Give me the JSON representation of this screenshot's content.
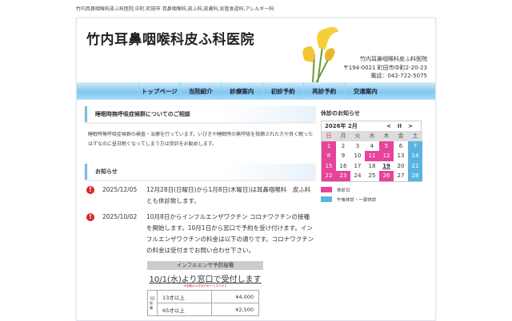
{
  "top_text": "竹内耳鼻咽喉科皮ふ科医院,中町,町田市 耳鼻咽喉科,皮ふ科,皮膚科,気管食道科,アレルギー科",
  "header": {
    "logo": "竹内耳鼻咽喉科皮ふ科医院",
    "address": [
      "竹内耳鼻咽喉科皮ふ科医院",
      "〒194-0021 町田市中町2-20-23",
      "電話：042-722-5075"
    ]
  },
  "nav": [
    "トップページ",
    "当院紹介",
    "診療案内",
    "初診予約",
    "再診予約",
    "交通案内"
  ],
  "section1": {
    "title": "睡眠時無呼吸症候群についてのご相談",
    "body": "睡眠時無呼吸症候群の検査・治療を行っています。いびきや睡眠時の無呼吸を指摘された方や良く眠ったはずなのに昼日眠くなってしまう方は受診をお勧めします。"
  },
  "section2": {
    "title": "お知らせ",
    "news": [
      {
        "icon": "alert-icon",
        "date": "2025/12/05",
        "text": "12月28日(日曜日)から1月8日(木曜日)は耳鼻咽喉科　皮ふ科とも休診致します。"
      },
      {
        "icon": "alert-icon",
        "date": "2025/10/02",
        "text": "10月8日からインフルエンザワクチン コロナワクチンの接種を開始します。10月1日から窓口で予約を受け付けます。インフルエンザワクチンの料金は以下の通りです。コロナワクチンの料金は受付までお問い合わせ下さい。"
      }
    ]
  },
  "flyer": {
    "title": "インフルエンザ予防接種",
    "headline": "10/1(水)より窓口で受付します",
    "note": "※接種は10月8日(水)〜となります",
    "side": "1回接種",
    "rows": [
      {
        "age": "13才以上",
        "price": "¥4,000"
      },
      {
        "age": "65才以上",
        "price": "¥2,500"
      }
    ]
  },
  "sidebar": {
    "title": "休診のお知らせ",
    "month": "2026年 2月",
    "prev": "<",
    "pause": "II",
    "next": ">",
    "weekdays": [
      "日",
      "月",
      "火",
      "水",
      "木",
      "金",
      "土"
    ],
    "days": [
      [
        {
          "d": "1",
          "t": "closed"
        },
        {
          "d": "2"
        },
        {
          "d": "3"
        },
        {
          "d": "4"
        },
        {
          "d": "5",
          "t": "closed"
        },
        {
          "d": "6"
        },
        {
          "d": "7",
          "t": "partial"
        }
      ],
      [
        {
          "d": "8",
          "t": "closed"
        },
        {
          "d": "9"
        },
        {
          "d": "10"
        },
        {
          "d": "11",
          "t": "closed"
        },
        {
          "d": "12",
          "t": "closed"
        },
        {
          "d": "13"
        },
        {
          "d": "14",
          "t": "partial"
        }
      ],
      [
        {
          "d": "15",
          "t": "closed"
        },
        {
          "d": "16"
        },
        {
          "d": "17"
        },
        {
          "d": "18"
        },
        {
          "d": "19",
          "t": "today"
        },
        {
          "d": "20"
        },
        {
          "d": "21",
          "t": "partial"
        }
      ],
      [
        {
          "d": "22",
          "t": "closed"
        },
        {
          "d": "23",
          "t": "closed"
        },
        {
          "d": "24"
        },
        {
          "d": "25"
        },
        {
          "d": "26",
          "t": "closed"
        },
        {
          "d": "27"
        },
        {
          "d": "28",
          "t": "partial"
        }
      ]
    ],
    "legend": [
      {
        "label": "休診日",
        "color": "#e5449a"
      },
      {
        "label": "午後休診・一部休診",
        "color": "#5ab4e2"
      }
    ]
  }
}
